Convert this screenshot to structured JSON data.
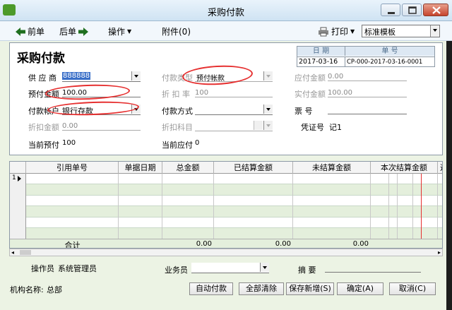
{
  "window": {
    "title": "采购付款"
  },
  "toolbar": {
    "prev": "前单",
    "next": "后单",
    "operate": "操作",
    "attach": "附件(0)",
    "print": "打印",
    "template": "标准模板"
  },
  "form": {
    "title": "采购付款",
    "date_header": "日  期",
    "number_header": "单      号",
    "date": "2017-03-16",
    "number": "CP-000-2017-03-16-0001",
    "supplier_label": "供 应 商",
    "supplier_value": "888888",
    "pay_type_label": "付款类型",
    "pay_type_value": "预付帐款",
    "due_label": "应付金额",
    "due_value": "0.00",
    "prepay_label": "预付金额",
    "prepay_value": "100.00",
    "discount_rate_label": "折 扣 率",
    "discount_rate_value": "100",
    "actual_label": "实付金额",
    "actual_value": "100.00",
    "account_label": "付款帐户",
    "account_value": "银行存款",
    "pay_method_label": "付款方式",
    "pay_method_value": "",
    "ticket_label": "票     号",
    "ticket_value": "",
    "discount_amount_label": "折扣金额",
    "discount_amount_value": "0.00",
    "discount_subject_label": "折扣科目",
    "voucher_label": "凭证号",
    "voucher_value": "记1",
    "current_prepay_label": "当前预付",
    "current_prepay_value": "100",
    "current_due_label": "当前应付",
    "current_due_value": "0"
  },
  "grid": {
    "columns": [
      "引用单号",
      "单据日期",
      "总金额",
      "已结算金额",
      "未结算金额",
      "本次结算金额",
      "这"
    ],
    "row_indicator": "1",
    "total_label": "合计",
    "totals": {
      "total": "0.00",
      "settled": "0.00",
      "unsettled": "0.00"
    }
  },
  "footer": {
    "operator_label": "操作员",
    "operator_value": "系统管理员",
    "salesman_label": "业务员",
    "summary_label": "摘    要",
    "org_label": "机构名称:",
    "org_value": "总部",
    "btn_autopay": "自动付款",
    "btn_clear": "全部清除",
    "btn_save_new": "保存新增(S)",
    "btn_ok": "确定(A)",
    "btn_cancel": "取消(C)"
  },
  "colors": {
    "annotation": "#e63030",
    "content_bg": "#ecf3e4",
    "header_box": "#dde8f3"
  }
}
